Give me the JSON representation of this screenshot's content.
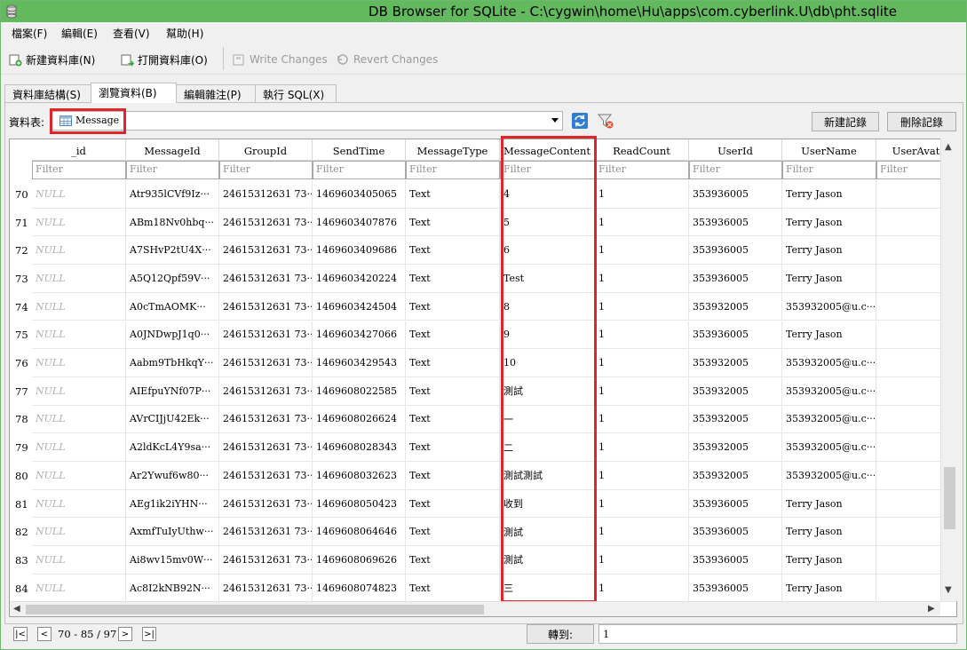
{
  "window": {
    "title": "DB Browser for SQLite - C:\\cygwin\\home\\Hu\\apps\\com.cyberlink.U\\db\\pht.sqlite"
  },
  "menu": [
    "檔案(F)",
    "編輯(E)",
    "查看(V)",
    "幫助(H)"
  ],
  "toolbar": {
    "new_db": "新建資料庫(N)",
    "open_db": "打開資料庫(O)",
    "write_changes": "Write Changes",
    "revert_changes": "Revert Changes"
  },
  "tabs": [
    "資料庫結構(S)",
    "瀏覽資料(B)",
    "編輯雜注(P)",
    "執行 SQL(X)"
  ],
  "browse": {
    "table_label": "資料表:",
    "table_value": "Message",
    "new_record": "新建記錄",
    "delete_record": "刪除記錄"
  },
  "grid": {
    "columns": [
      "_id",
      "MessageId",
      "GroupId",
      "SendTime",
      "MessageType",
      "MessageContent",
      "ReadCount",
      "UserId",
      "UserName",
      "UserAvat"
    ],
    "filter_placeholder": "Filter",
    "rows": [
      [
        "70",
        "NULL",
        "Atr935lCVf9Iz···",
        "24615312631 73···",
        "1469603405065",
        "Text",
        "4",
        "1",
        "353936005",
        "Terry Jason"
      ],
      [
        "71",
        "NULL",
        "ABm18Nv0hbq···",
        "24615312631 73···",
        "1469603407876",
        "Text",
        "5",
        "1",
        "353936005",
        "Terry Jason"
      ],
      [
        "72",
        "NULL",
        "A7SHvP2tU4X···",
        "24615312631 73···",
        "1469603409686",
        "Text",
        "6",
        "1",
        "353936005",
        "Terry Jason"
      ],
      [
        "73",
        "NULL",
        "A5Q12Qpf59V···",
        "24615312631 73···",
        "1469603420224",
        "Text",
        "Test",
        "1",
        "353936005",
        "Terry Jason"
      ],
      [
        "74",
        "NULL",
        "A0cTmAOMK···",
        "24615312631 73···",
        "1469603424504",
        "Text",
        "8",
        "1",
        "353932005",
        "353932005@u.c···"
      ],
      [
        "75",
        "NULL",
        "A0JNDwpJ1q0···",
        "24615312631 73···",
        "1469603427066",
        "Text",
        "9",
        "1",
        "353936005",
        "Terry Jason"
      ],
      [
        "76",
        "NULL",
        "Aabm9TbHkqY···",
        "24615312631 73···",
        "1469603429543",
        "Text",
        "10",
        "1",
        "353932005",
        "353932005@u.c···"
      ],
      [
        "77",
        "NULL",
        "AIEfpuYNf07P···",
        "24615312631 73···",
        "1469608022585",
        "Text",
        "測試",
        "1",
        "353932005",
        "353932005@u.c···"
      ],
      [
        "78",
        "NULL",
        "AVrCIJjU42Ek···",
        "24615312631 73···",
        "1469608026624",
        "Text",
        "一",
        "1",
        "353932005",
        "353932005@u.c···"
      ],
      [
        "79",
        "NULL",
        "A2ldKcL4Y9sa···",
        "24615312631 73···",
        "1469608028343",
        "Text",
        "二",
        "1",
        "353932005",
        "353932005@u.c···"
      ],
      [
        "80",
        "NULL",
        "Ar2Ywuf6w80···",
        "24615312631 73···",
        "1469608032623",
        "Text",
        "測試測試",
        "1",
        "353932005",
        "353932005@u.c···"
      ],
      [
        "81",
        "NULL",
        "AEg1ik2iYHN···",
        "24615312631 73···",
        "1469608050423",
        "Text",
        "收到",
        "1",
        "353936005",
        "Terry Jason"
      ],
      [
        "82",
        "NULL",
        "AxmfTuIyUthw···",
        "24615312631 73···",
        "1469608064646",
        "Text",
        "測試",
        "1",
        "353936005",
        "Terry Jason"
      ],
      [
        "83",
        "NULL",
        "Ai8wv15mv0W···",
        "24615312631 73···",
        "1469608069626",
        "Text",
        "測試",
        "1",
        "353936005",
        "Terry Jason"
      ],
      [
        "84",
        "NULL",
        "Ac8I2kNB92N···",
        "24615312631 73···",
        "1469608074823",
        "Text",
        "三",
        "1",
        "353936005",
        "Terry Jason"
      ]
    ]
  },
  "nav": {
    "first": "|<",
    "prev": "<",
    "range": "70 - 85 / 97",
    "next": ">",
    "last": ">|",
    "goto_label": "轉到:",
    "goto_value": "1"
  },
  "colors": {
    "titlebar": "#63b95d",
    "highlight": "#e0262b"
  }
}
